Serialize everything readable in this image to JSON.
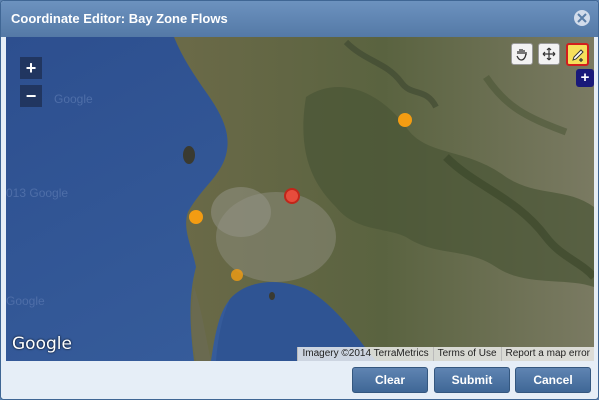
{
  "dialog": {
    "title": "Coordinate Editor: Bay Zone Flows"
  },
  "map": {
    "zoom_in": "+",
    "zoom_out": "−",
    "tools": [
      {
        "name": "pan-hand-tool",
        "icon": "hand-icon"
      },
      {
        "name": "move-tool",
        "icon": "move-arrows-icon"
      },
      {
        "name": "draw-point-tool",
        "icon": "pencil-icon",
        "active": true
      }
    ],
    "add_label": "+",
    "markers": [
      {
        "color": "#f39c12",
        "type": "point"
      },
      {
        "color": "#e74c3c",
        "type": "point-selected"
      },
      {
        "color": "#f39c12",
        "type": "point"
      },
      {
        "color": "#f39c12",
        "type": "point"
      }
    ],
    "logo": "Google",
    "attribution": {
      "imagery": "Imagery ©2014 TerraMetrics",
      "terms": "Terms of Use",
      "report": "Report a map error"
    }
  },
  "footer": {
    "clear_label": "Clear",
    "submit_label": "Submit",
    "cancel_label": "Cancel"
  },
  "colors": {
    "title_bar": "#5a7fab",
    "button": "#4a72a2",
    "active_tool": "#f6df5b",
    "selected_marker": "#e74c3c",
    "marker": "#f39c12"
  }
}
